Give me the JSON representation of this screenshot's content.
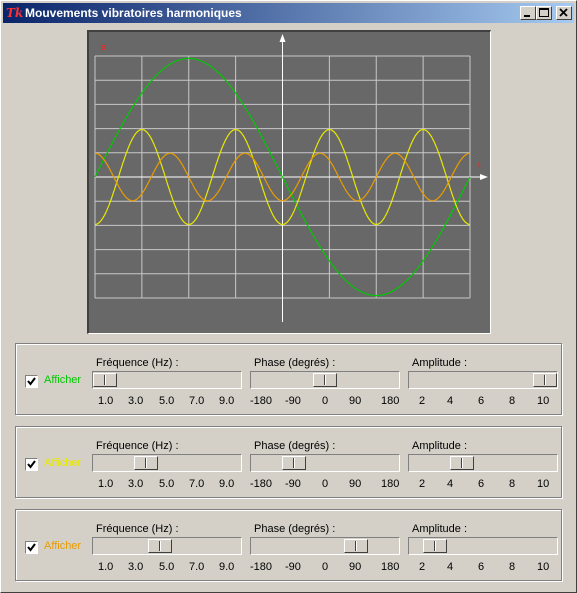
{
  "window": {
    "title": "Mouvements vibratoires harmoniques",
    "app_icon": "Tk"
  },
  "scope": {
    "y_axis_label": "e",
    "x_axis_label": "t",
    "background": "#686868",
    "grid_color": "#c8c8c8",
    "axis_color": "#ffffff"
  },
  "chart_data": {
    "type": "line",
    "x_axis_label": "t",
    "y_axis_label": "e",
    "grid": true,
    "x_range": [
      -4,
      4
    ],
    "y_range": [
      -5,
      5
    ],
    "series": [
      {
        "color": "#00c800",
        "amplitude": 10,
        "frequency": 1.0,
        "phase": 0
      },
      {
        "color": "#e8e800",
        "amplitude": 4,
        "frequency": 4.0,
        "phase": -90
      },
      {
        "color": "#e89c00",
        "amplitude": 2,
        "frequency": 5.0,
        "phase": 90
      }
    ]
  },
  "panels": [
    {
      "checkbox_label": "Afficher",
      "checked": true,
      "color": "#00c800",
      "frequency_label": "Fréquence (Hz) :",
      "phase_label": "Phase (degrés) :",
      "amplitude_label": "Amplitude :",
      "frequency_value": 1.0,
      "phase_value": 0,
      "amplitude_value": 10
    },
    {
      "checkbox_label": "Afficher",
      "checked": true,
      "color": "#e8e800",
      "frequency_label": "Fréquence (Hz) :",
      "phase_label": "Phase (degrés) :",
      "amplitude_label": "Amplitude :",
      "frequency_value": 4.0,
      "phase_value": -90,
      "amplitude_value": 4
    },
    {
      "checkbox_label": "Afficher",
      "checked": true,
      "color": "#e89c00",
      "frequency_label": "Fréquence (Hz) :",
      "phase_label": "Phase (degrés) :",
      "amplitude_label": "Amplitude :",
      "frequency_value": 5.0,
      "phase_value": 90,
      "amplitude_value": 2
    }
  ],
  "frequency_ticks": [
    "1.0",
    "3.0",
    "5.0",
    "7.0",
    "9.0"
  ],
  "phase_ticks": [
    "-180",
    "-90",
    "0",
    "90",
    "180"
  ],
  "amplitude_ticks": [
    "2",
    "4",
    "6",
    "8",
    "10"
  ],
  "icons": [
    "minimize-icon",
    "maximize-icon",
    "close-icon",
    "check-icon"
  ]
}
